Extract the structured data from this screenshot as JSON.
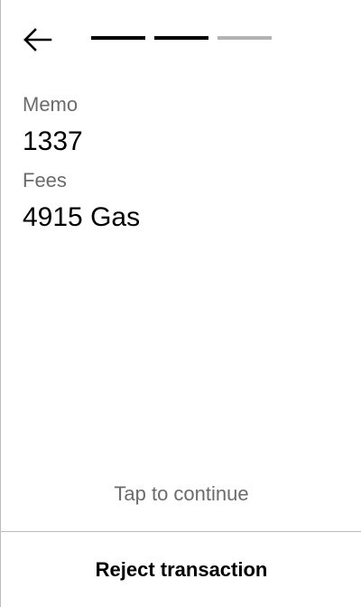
{
  "header": {
    "back_icon": "arrow-left-icon",
    "progress": {
      "total_steps": 3,
      "completed_steps": 2,
      "active_color": "#000000",
      "inactive_color": "#b3b3b3"
    }
  },
  "details": {
    "memo": {
      "label": "Memo",
      "value": "1337"
    },
    "fees": {
      "label": "Fees",
      "value": "4915 Gas"
    }
  },
  "footer": {
    "tap_hint": "Tap to continue",
    "reject_label": "Reject transaction"
  }
}
